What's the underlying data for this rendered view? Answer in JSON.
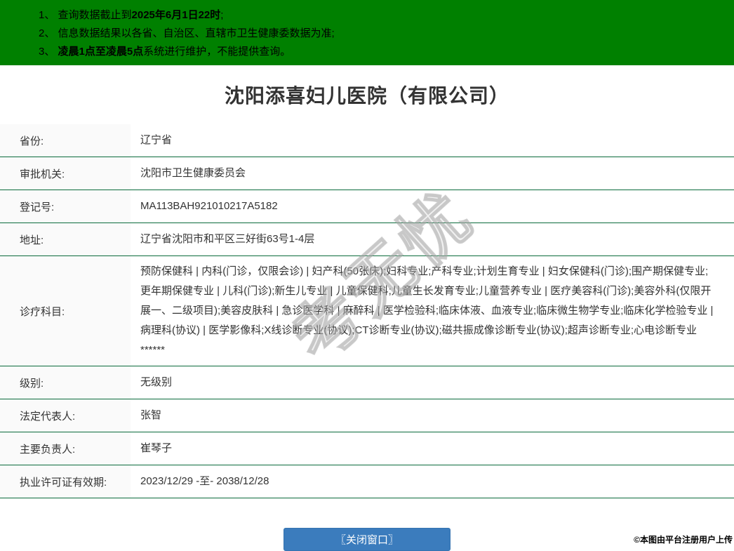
{
  "notices": [
    {
      "prefix": "1、 查询数据截止到",
      "bold": "2025年6月1日22时",
      "suffix": ";"
    },
    {
      "prefix": "2、 信息数据结果以各省、自治区、直辖市卫生健康委数据为准;",
      "bold": "",
      "suffix": ""
    },
    {
      "prefix": "3、 ",
      "bold": "凌晨1点至凌晨5点",
      "suffix": "系统进行维护，不能提供查询。"
    }
  ],
  "title": "沈阳添喜妇儿医院（有限公司）",
  "table": {
    "rows": [
      {
        "label": "省份:",
        "value": "辽宁省"
      },
      {
        "label": "审批机关:",
        "value": "沈阳市卫生健康委员会"
      },
      {
        "label": "登记号:",
        "value": "MA113BAH921010217A5182"
      },
      {
        "label": "地址:",
        "value": "辽宁省沈阳市和平区三好街63号1-4层"
      },
      {
        "label": "诊疗科目:",
        "value": "预防保健科 | 内科(门诊，仅限会诊) | 妇产科(50张床);妇科专业;产科专业;计划生育专业 | 妇女保健科(门诊);围产期保健专业;更年期保健专业 | 儿科(门诊);新生儿专业 | 儿童保健科;儿童生长发育专业;儿童营养专业 | 医疗美容科(门诊);美容外科(仅限开展一、二级项目);美容皮肤科 | 急诊医学科 | 麻醉科 | 医学检验科;临床体液、血液专业;临床微生物学专业;临床化学检验专业 | 病理科(协议) | 医学影像科;X线诊断专业(协议);CT诊断专业(协议);磁共振成像诊断专业(协议);超声诊断专业;心电诊断专业******"
      },
      {
        "label": "级别:",
        "value": "无级别"
      },
      {
        "label": "法定代表人:",
        "value": "张智"
      },
      {
        "label": "主要负责人:",
        "value": "崔琴子"
      },
      {
        "label": "执业许可证有效期:",
        "value": "2023/12/29 -至- 2038/12/28"
      }
    ]
  },
  "close_button_label": "〖关闭窗口〗",
  "watermark": {
    "text": "考无忧"
  },
  "credit": "©本图由平台注册用户上传",
  "colors": {
    "header_green": "#008000",
    "row_border_green": "#0b6b3c",
    "button_blue": "#3b7cbd",
    "label_bg": "#fafafa",
    "text": "#333333"
  }
}
